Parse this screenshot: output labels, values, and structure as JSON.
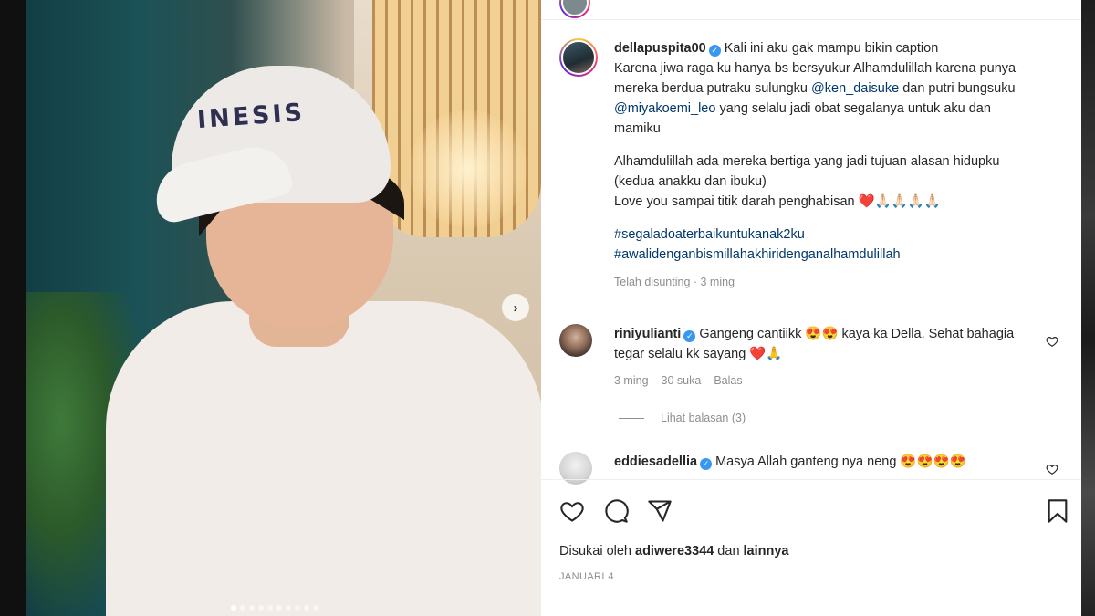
{
  "post": {
    "author": "dellapuspita00",
    "caption": {
      "line1": "Kali ini aku gak mampu bikin caption",
      "line2_a": "Karena jiwa raga ku hanya bs bersyukur Alhamdulillah karena punya mereka berdua putraku sulungku ",
      "mention1": "@ken_daisuke",
      "line2_b": " dan putri bungsuku ",
      "mention2": "@miyakoemi_leo",
      "line2_c": " yang selalu jadi obat segalanya untuk aku dan mamiku",
      "para2": "Alhamdulillah ada mereka bertiga yang jadi tujuan alasan hidupku (kedua anakku dan ibuku)",
      "para3": "Love you sampai titik darah penghabisan ❤️🙏🏻🙏🏻🙏🏻🙏🏻",
      "hashtag1": "#segaladoaterbaikuntukanak2ku",
      "hashtag2": "#awalidenganbismillahakhiridenganalhamdulillah",
      "edited": "Telah disunting · 3 ming"
    },
    "photo": {
      "cap_logo": "INESIS",
      "carousel_dots": 10,
      "active_dot": 0
    }
  },
  "comments": [
    {
      "user": "riniyulianti",
      "text": "Gangeng cantiikk 😍😍 kaya ka Della. Sehat bahagia tegar selalu kk sayang ❤️🙏",
      "time": "3 ming",
      "likes": "30 suka",
      "reply": "Balas"
    },
    {
      "user": "eddiesadellia",
      "text": "Masya Allah ganteng nya neng 😍😍😍😍"
    }
  ],
  "view_replies": "Lihat balasan (3)",
  "likes": {
    "prefix": "Disukai oleh ",
    "user": "adiwere3344",
    "middle": " dan ",
    "others": "lainnya"
  },
  "date": "JANUARI 4",
  "icons": [
    "heart-icon",
    "comment-icon",
    "share-icon",
    "bookmark-icon",
    "chevron-right-icon"
  ]
}
